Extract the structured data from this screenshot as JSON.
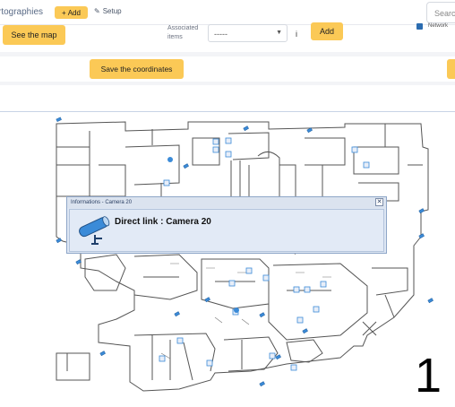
{
  "header": {
    "app_title": "rtographies",
    "add_label": "Add",
    "setup_label": "Setup",
    "search_placeholder": "Searc"
  },
  "controls": {
    "see_map_label": "See the map",
    "associated_items_label": "Associated items",
    "select_value": "-----",
    "info_icon": "i",
    "add_label": "Add",
    "network_label": "Network",
    "save_coordinates_label": "Save the coordinates"
  },
  "popup": {
    "title": "Informations - Camera 20",
    "close_label": "✕",
    "link_text": "Direct link : Camera 20"
  },
  "map": {
    "floor_number": "1"
  },
  "colors": {
    "accent": "#fbc956",
    "camera_icon": "#3b8bd8",
    "popup_bg": "#dde6f3"
  }
}
